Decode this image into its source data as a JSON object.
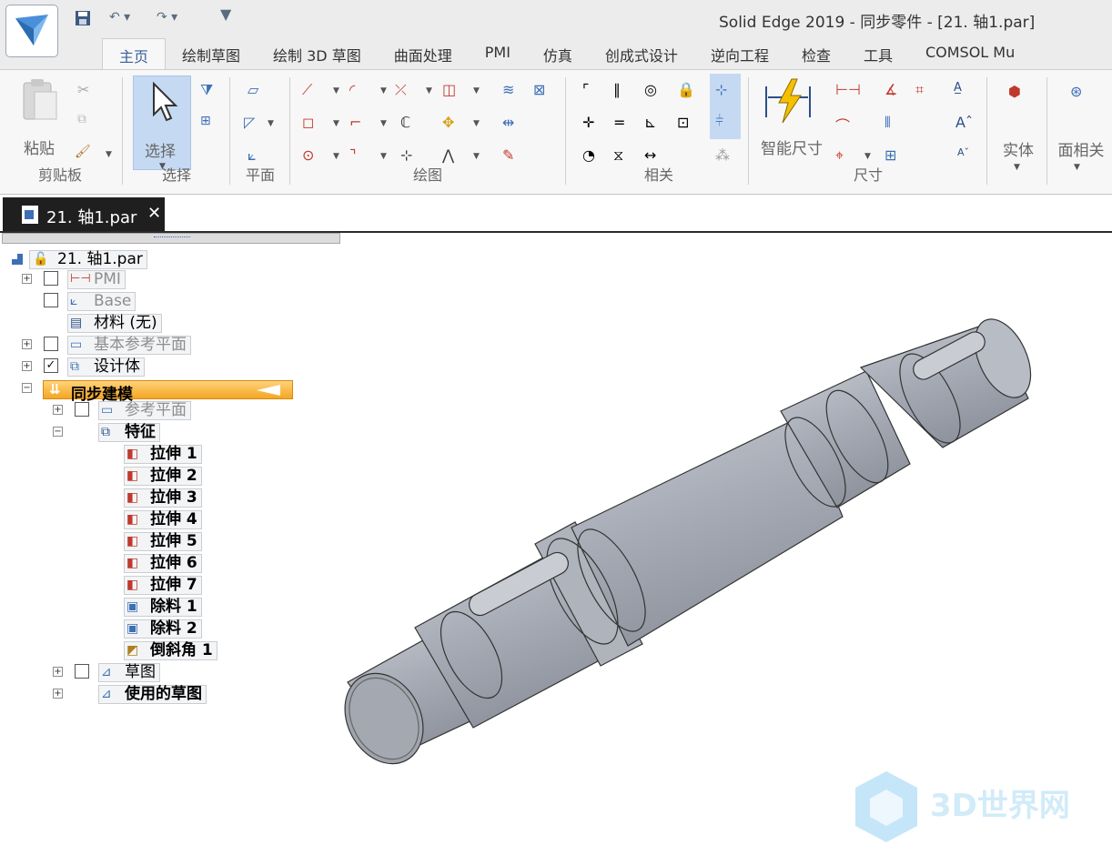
{
  "window": {
    "title": "Solid Edge 2019 - 同步零件 - [21. 轴1.par]"
  },
  "ribbon_tabs": [
    "主页",
    "绘制草图",
    "绘制 3D 草图",
    "曲面处理",
    "PMI",
    "仿真",
    "创成式设计",
    "逆向工程",
    "检查",
    "工具",
    "COMSOL Mu"
  ],
  "ribbon_groups": {
    "clipboard": {
      "label": "剪贴板",
      "paste": "粘贴"
    },
    "select": {
      "label": "选择",
      "select": "选择"
    },
    "plane": {
      "label": "平面"
    },
    "draw": {
      "label": "绘图"
    },
    "relate": {
      "label": "相关"
    },
    "dimension": {
      "label": "尺寸",
      "smart": "智能尺寸"
    },
    "solid": {
      "label": "实体"
    },
    "face": {
      "label": "面相关"
    }
  },
  "document_tab": {
    "label": "21. 轴1.par",
    "close": "✕"
  },
  "tree": {
    "root": "21. 轴1.par",
    "pmi": "PMI",
    "base": "Base",
    "material": "材料 (无)",
    "base_planes": "基本参考平面",
    "design_body": "设计体",
    "sync": "同步建模",
    "ref_planes": "参考平面",
    "features": "特征",
    "feature_items": [
      "拉伸 1",
      "拉伸 2",
      "拉伸 3",
      "拉伸 4",
      "拉伸 5",
      "拉伸 6",
      "拉伸 7",
      "除料 1",
      "除料 2",
      "倒斜角 1"
    ],
    "sketch": "草图",
    "used_sketch": "使用的草图"
  },
  "watermark": {
    "text": "3D世界网"
  },
  "colors": {
    "accent": "#3a5f9a",
    "sync_highlight": "#f5a623",
    "shaft": "#a9aeb8"
  }
}
